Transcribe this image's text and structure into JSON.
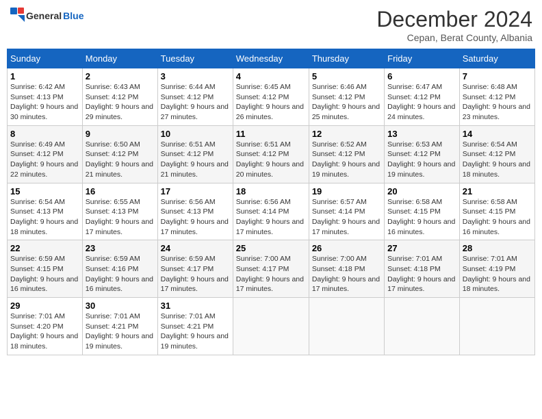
{
  "header": {
    "logo_general": "General",
    "logo_blue": "Blue",
    "month": "December 2024",
    "location": "Cepan, Berat County, Albania"
  },
  "days_of_week": [
    "Sunday",
    "Monday",
    "Tuesday",
    "Wednesday",
    "Thursday",
    "Friday",
    "Saturday"
  ],
  "weeks": [
    [
      {
        "day": "1",
        "sunrise": "6:42 AM",
        "sunset": "4:13 PM",
        "daylight": "9 hours and 30 minutes."
      },
      {
        "day": "2",
        "sunrise": "6:43 AM",
        "sunset": "4:12 PM",
        "daylight": "9 hours and 29 minutes."
      },
      {
        "day": "3",
        "sunrise": "6:44 AM",
        "sunset": "4:12 PM",
        "daylight": "9 hours and 27 minutes."
      },
      {
        "day": "4",
        "sunrise": "6:45 AM",
        "sunset": "4:12 PM",
        "daylight": "9 hours and 26 minutes."
      },
      {
        "day": "5",
        "sunrise": "6:46 AM",
        "sunset": "4:12 PM",
        "daylight": "9 hours and 25 minutes."
      },
      {
        "day": "6",
        "sunrise": "6:47 AM",
        "sunset": "4:12 PM",
        "daylight": "9 hours and 24 minutes."
      },
      {
        "day": "7",
        "sunrise": "6:48 AM",
        "sunset": "4:12 PM",
        "daylight": "9 hours and 23 minutes."
      }
    ],
    [
      {
        "day": "8",
        "sunrise": "6:49 AM",
        "sunset": "4:12 PM",
        "daylight": "9 hours and 22 minutes."
      },
      {
        "day": "9",
        "sunrise": "6:50 AM",
        "sunset": "4:12 PM",
        "daylight": "9 hours and 21 minutes."
      },
      {
        "day": "10",
        "sunrise": "6:51 AM",
        "sunset": "4:12 PM",
        "daylight": "9 hours and 21 minutes."
      },
      {
        "day": "11",
        "sunrise": "6:51 AM",
        "sunset": "4:12 PM",
        "daylight": "9 hours and 20 minutes."
      },
      {
        "day": "12",
        "sunrise": "6:52 AM",
        "sunset": "4:12 PM",
        "daylight": "9 hours and 19 minutes."
      },
      {
        "day": "13",
        "sunrise": "6:53 AM",
        "sunset": "4:12 PM",
        "daylight": "9 hours and 19 minutes."
      },
      {
        "day": "14",
        "sunrise": "6:54 AM",
        "sunset": "4:12 PM",
        "daylight": "9 hours and 18 minutes."
      }
    ],
    [
      {
        "day": "15",
        "sunrise": "6:54 AM",
        "sunset": "4:13 PM",
        "daylight": "9 hours and 18 minutes."
      },
      {
        "day": "16",
        "sunrise": "6:55 AM",
        "sunset": "4:13 PM",
        "daylight": "9 hours and 17 minutes."
      },
      {
        "day": "17",
        "sunrise": "6:56 AM",
        "sunset": "4:13 PM",
        "daylight": "9 hours and 17 minutes."
      },
      {
        "day": "18",
        "sunrise": "6:56 AM",
        "sunset": "4:14 PM",
        "daylight": "9 hours and 17 minutes."
      },
      {
        "day": "19",
        "sunrise": "6:57 AM",
        "sunset": "4:14 PM",
        "daylight": "9 hours and 17 minutes."
      },
      {
        "day": "20",
        "sunrise": "6:58 AM",
        "sunset": "4:15 PM",
        "daylight": "9 hours and 16 minutes."
      },
      {
        "day": "21",
        "sunrise": "6:58 AM",
        "sunset": "4:15 PM",
        "daylight": "9 hours and 16 minutes."
      }
    ],
    [
      {
        "day": "22",
        "sunrise": "6:59 AM",
        "sunset": "4:15 PM",
        "daylight": "9 hours and 16 minutes."
      },
      {
        "day": "23",
        "sunrise": "6:59 AM",
        "sunset": "4:16 PM",
        "daylight": "9 hours and 16 minutes."
      },
      {
        "day": "24",
        "sunrise": "6:59 AM",
        "sunset": "4:17 PM",
        "daylight": "9 hours and 17 minutes."
      },
      {
        "day": "25",
        "sunrise": "7:00 AM",
        "sunset": "4:17 PM",
        "daylight": "9 hours and 17 minutes."
      },
      {
        "day": "26",
        "sunrise": "7:00 AM",
        "sunset": "4:18 PM",
        "daylight": "9 hours and 17 minutes."
      },
      {
        "day": "27",
        "sunrise": "7:01 AM",
        "sunset": "4:18 PM",
        "daylight": "9 hours and 17 minutes."
      },
      {
        "day": "28",
        "sunrise": "7:01 AM",
        "sunset": "4:19 PM",
        "daylight": "9 hours and 18 minutes."
      }
    ],
    [
      {
        "day": "29",
        "sunrise": "7:01 AM",
        "sunset": "4:20 PM",
        "daylight": "9 hours and 18 minutes."
      },
      {
        "day": "30",
        "sunrise": "7:01 AM",
        "sunset": "4:21 PM",
        "daylight": "9 hours and 19 minutes."
      },
      {
        "day": "31",
        "sunrise": "7:01 AM",
        "sunset": "4:21 PM",
        "daylight": "9 hours and 19 minutes."
      },
      null,
      null,
      null,
      null
    ]
  ]
}
